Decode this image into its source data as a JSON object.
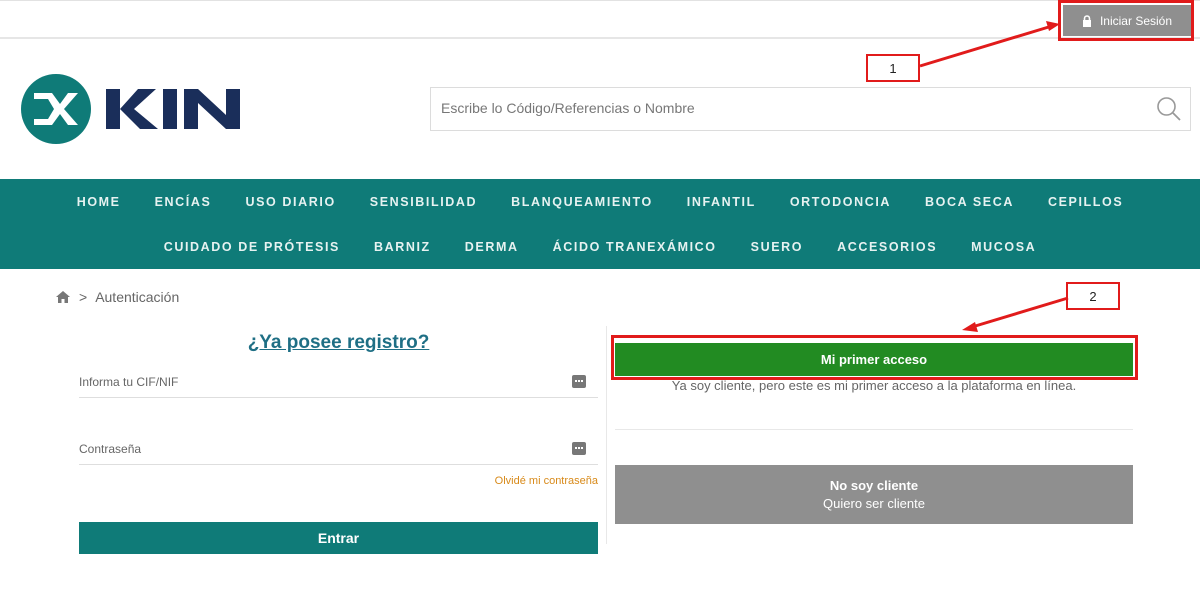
{
  "topbar": {
    "login_label": "Iniciar Sesión"
  },
  "brand": {
    "name": "KIN",
    "logo_color": "#1a2e5a",
    "mark_color": "#0f7b78"
  },
  "search": {
    "placeholder": "Escribe lo Código/Referencias o Nombre"
  },
  "nav": {
    "row1": [
      "HOME",
      "ENCÍAS",
      "USO DIARIO",
      "SENSIBILIDAD",
      "BLANQUEAMIENTO",
      "INFANTIL",
      "ORTODONCIA",
      "BOCA SECA",
      "CEPILLOS"
    ],
    "row2": [
      "CUIDADO DE PRÓTESIS",
      "BARNIZ",
      "DERMA",
      "ÁCIDO TRANEXÁMICO",
      "SUERO",
      "ACCESORIOS",
      "MUCOSA"
    ],
    "bg_color": "#0f7b78"
  },
  "breadcrumb": {
    "separator": ">",
    "current": "Autenticación"
  },
  "login": {
    "title": "¿Ya posee registro?",
    "cif_placeholder": "Informa tu CIF/NIF",
    "password_placeholder": "Contraseña",
    "forgot_label": "Olvidé mi contraseña",
    "enter_label": "Entrar"
  },
  "first_access": {
    "button_label": "Mi primer acceso",
    "description": "Ya soy cliente, pero este es mi primer acceso a la plataforma en línea.",
    "button_color": "#228b22"
  },
  "not_client": {
    "line1": "No soy cliente",
    "line2": "Quiero ser cliente"
  },
  "annotations": {
    "label1": "1",
    "label2": "2",
    "color": "#e11b1b"
  }
}
